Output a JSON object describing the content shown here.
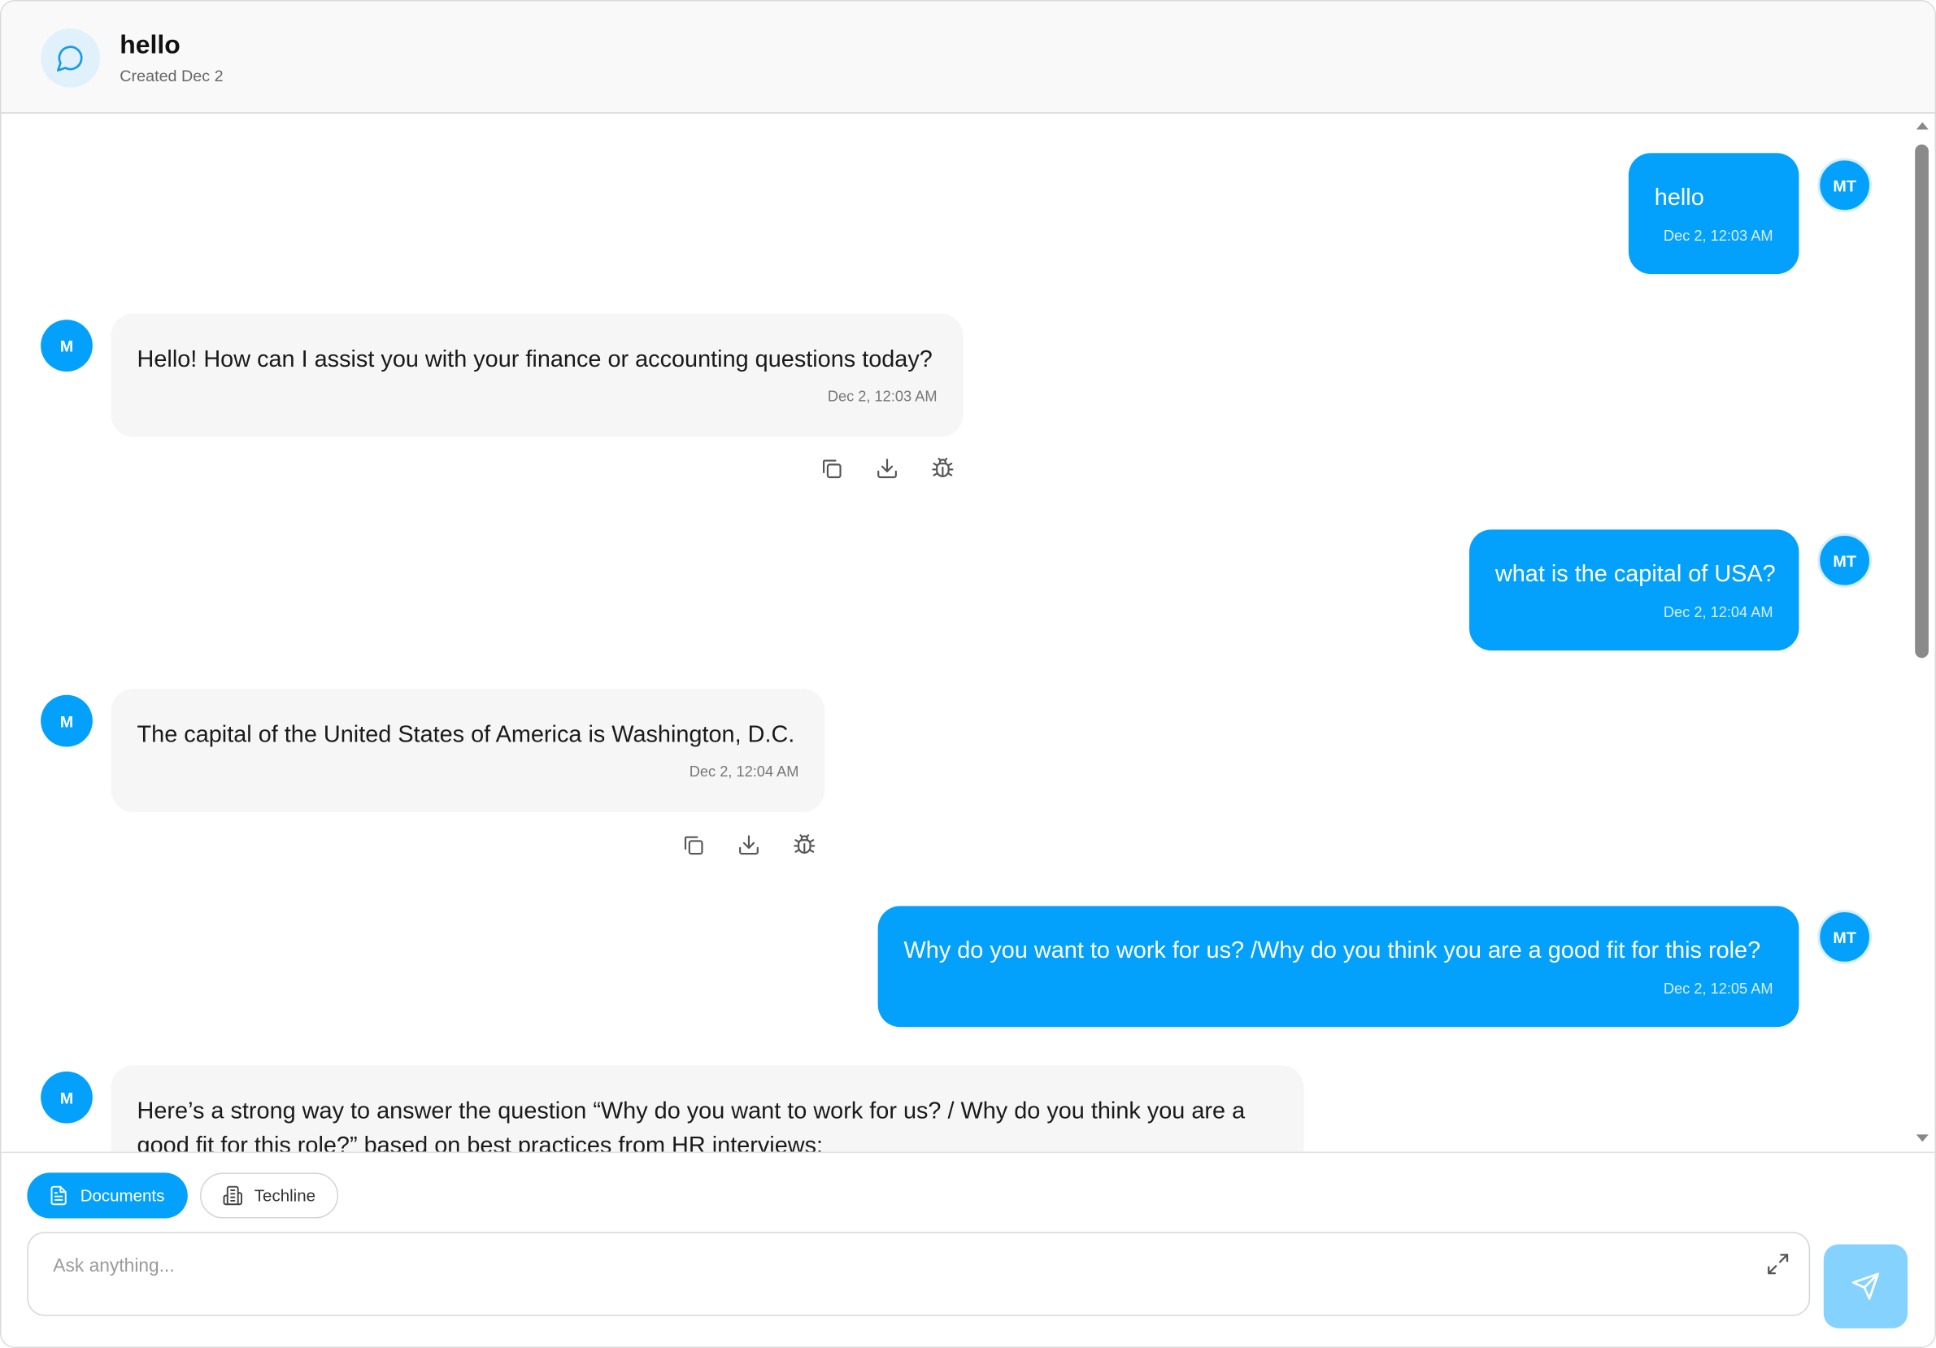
{
  "header": {
    "title": "hello",
    "subtitle": "Created Dec 2",
    "icon": "chat-bubble-icon"
  },
  "messages": [
    {
      "role": "user",
      "avatar": "MT",
      "text": "hello",
      "time": "Dec 2, 12:03 AM"
    },
    {
      "role": "assistant",
      "avatar": "M",
      "text": "Hello! How can I assist you with your finance or accounting questions today?",
      "time": "Dec 2, 12:03 AM"
    },
    {
      "role": "user",
      "avatar": "MT",
      "text": "what is the capital of USA?",
      "time": "Dec 2, 12:04 AM"
    },
    {
      "role": "assistant",
      "avatar": "M",
      "text": "The capital of the United States of America is Washington, D.C.",
      "time": "Dec 2, 12:04 AM"
    },
    {
      "role": "user",
      "avatar": "MT",
      "text": "Why do you want to work for us? /Why do you think you are a good fit for this role?",
      "time": "Dec 2, 12:05 AM"
    },
    {
      "role": "assistant",
      "avatar": "M",
      "text": "Here’s a strong way to answer the question “Why do you want to work for us? / Why do you think you are a good fit for this role?” based on best practices from HR interviews:",
      "time": ""
    }
  ],
  "message_actions": {
    "copy": "copy-icon",
    "download": "download-icon",
    "report": "bug-icon"
  },
  "footer": {
    "chips": [
      {
        "label": "Documents",
        "icon": "document-icon",
        "active": true
      },
      {
        "label": "Techline",
        "icon": "building-icon",
        "active": false
      }
    ],
    "input_placeholder": "Ask anything...",
    "input_value": "",
    "expand_icon": "expand-icon",
    "send_icon": "send-icon"
  },
  "colors": {
    "accent": "#03a1fb",
    "send_disabled": "#84d2fd",
    "bot_bubble": "#f6f6f6",
    "header_bg": "#f9f9f9"
  }
}
